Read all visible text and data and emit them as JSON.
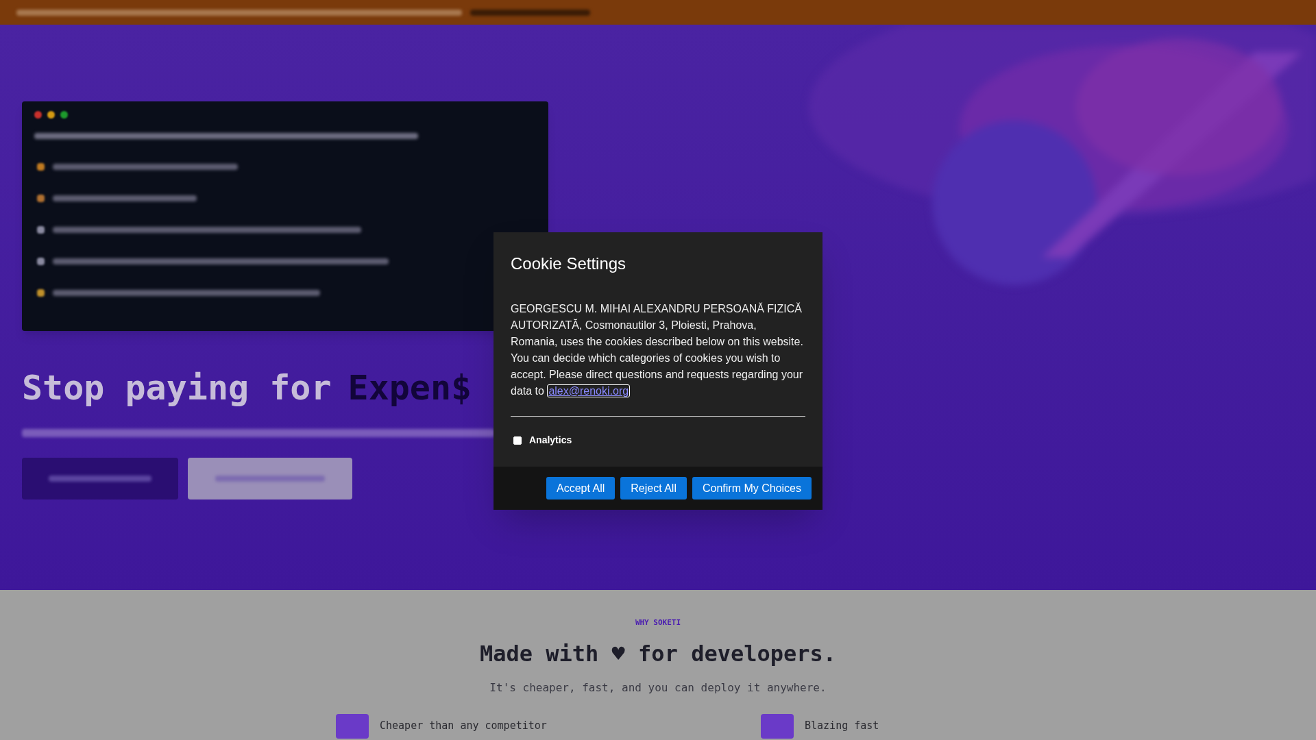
{
  "hero": {
    "title": "Stop paying for",
    "highlight": "Expen$",
    "buttons": [
      {
        "kind": "primary"
      },
      {
        "kind": "secondary"
      }
    ]
  },
  "why": {
    "eyebrow": "WHY SOKETI",
    "title": "Made with ♥ for developers.",
    "subtitle": "It's cheaper, fast, and you can deploy it anywhere.",
    "features": [
      "Cheaper than any competitor",
      "Blazing fast"
    ]
  },
  "cookie_dialog": {
    "title": "Cookie Settings",
    "body": "GEORGESCU M. MIHAI ALEXANDRU PERSOANĂ FIZICĂ AUTORIZATĂ, Cosmonautilor 3, Ploiesti, Prahova, Romania, uses the cookies described below on this website. You can decide which categories of cookies you wish to accept. Please direct questions and requests regarding your data to",
    "email": "alex@renoki.org",
    "categories": [
      {
        "label": "Analytics",
        "checked": false
      }
    ],
    "buttons": [
      "Accept All",
      "Reject All",
      "Confirm My Choices"
    ]
  }
}
